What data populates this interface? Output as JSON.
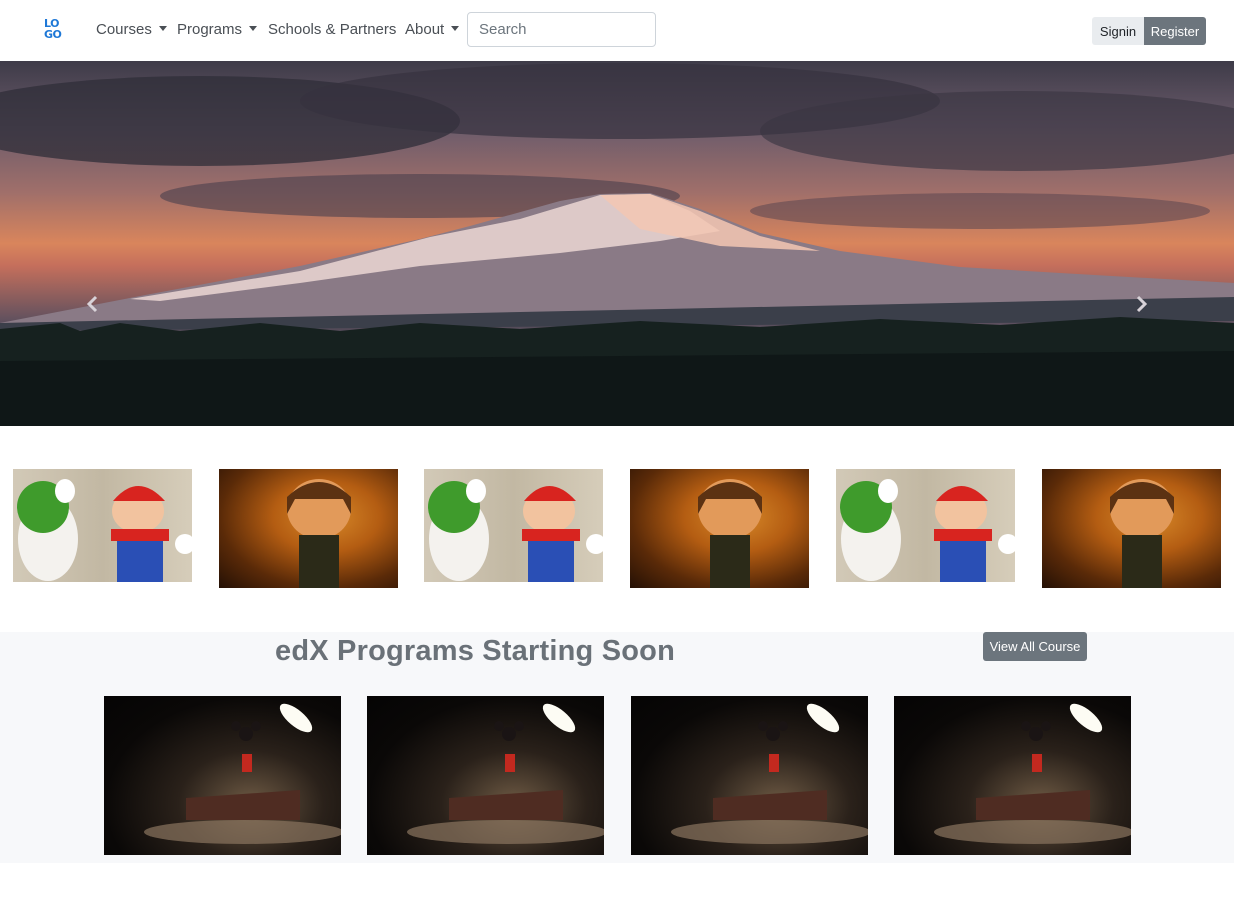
{
  "navbar": {
    "logo_top": "LO",
    "logo_bottom": "GO",
    "items": [
      {
        "label": "Courses",
        "dropdown": true
      },
      {
        "label": "Programs",
        "dropdown": true
      },
      {
        "label": "Schools & Partners",
        "dropdown": false
      },
      {
        "label": "About",
        "dropdown": true
      }
    ],
    "search_placeholder": "Search",
    "signin_label": "Signin",
    "register_label": "Register"
  },
  "hero": {
    "prev_icon": "chevron-left-icon",
    "next_icon": "chevron-right-icon"
  },
  "programs": {
    "title": "edX Programs Starting Soon",
    "view_all_label": "View All Course"
  },
  "colors": {
    "primary_text": "#212529",
    "muted_text": "#6a7178",
    "button_secondary": "#6c757d",
    "button_light": "#e9ecef",
    "logo_blue": "#1e78d7",
    "section_bg": "#f7f8fa"
  }
}
